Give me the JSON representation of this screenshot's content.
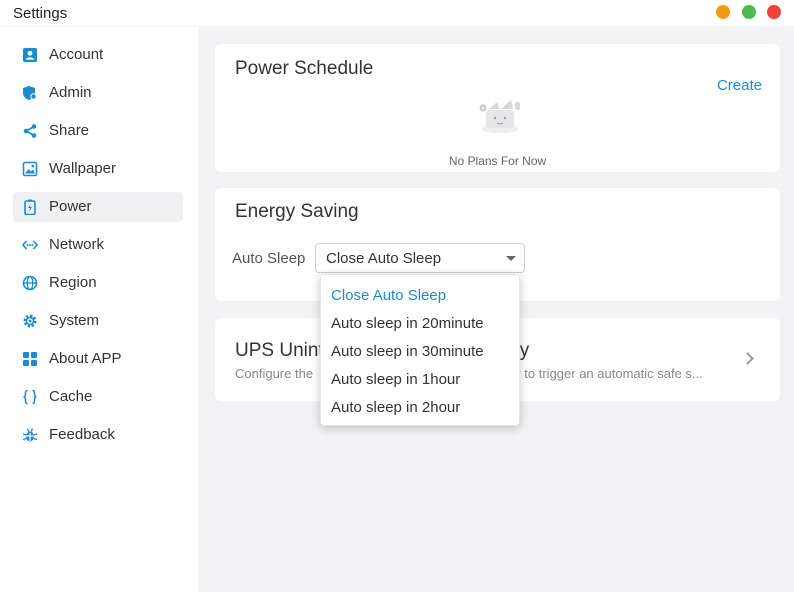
{
  "window": {
    "title": "Settings"
  },
  "sidebar": {
    "items": [
      {
        "label": "Account",
        "icon": "account-icon"
      },
      {
        "label": "Admin",
        "icon": "admin-shield-icon"
      },
      {
        "label": "Share",
        "icon": "share-icon"
      },
      {
        "label": "Wallpaper",
        "icon": "wallpaper-icon"
      },
      {
        "label": "Power",
        "icon": "battery-icon",
        "active": true
      },
      {
        "label": "Network",
        "icon": "network-icon"
      },
      {
        "label": "Region",
        "icon": "globe-icon"
      },
      {
        "label": "System",
        "icon": "gear-icon"
      },
      {
        "label": "About APP",
        "icon": "grid-icon"
      },
      {
        "label": "Cache",
        "icon": "braces-icon"
      },
      {
        "label": "Feedback",
        "icon": "bug-icon"
      }
    ]
  },
  "power_schedule": {
    "title": "Power Schedule",
    "create_label": "Create",
    "empty_text": "No Plans For Now"
  },
  "energy_saving": {
    "title": "Energy Saving",
    "auto_sleep_label": "Auto Sleep",
    "selected_value": "Close Auto Sleep",
    "options": [
      "Close Auto Sleep",
      "Auto sleep in 20minute",
      "Auto sleep in 30minute",
      "Auto sleep in 1hour",
      "Auto sleep in 2hour"
    ]
  },
  "ups": {
    "title": "UPS Unint",
    "title_tail": "y",
    "desc": "Configure the",
    "desc_tail": "ply to trigger an automatic safe s..."
  },
  "colors": {
    "accent": "#1a8ccf",
    "min": "#f39c12",
    "max": "#4cba4d",
    "close": "#f0443a"
  }
}
